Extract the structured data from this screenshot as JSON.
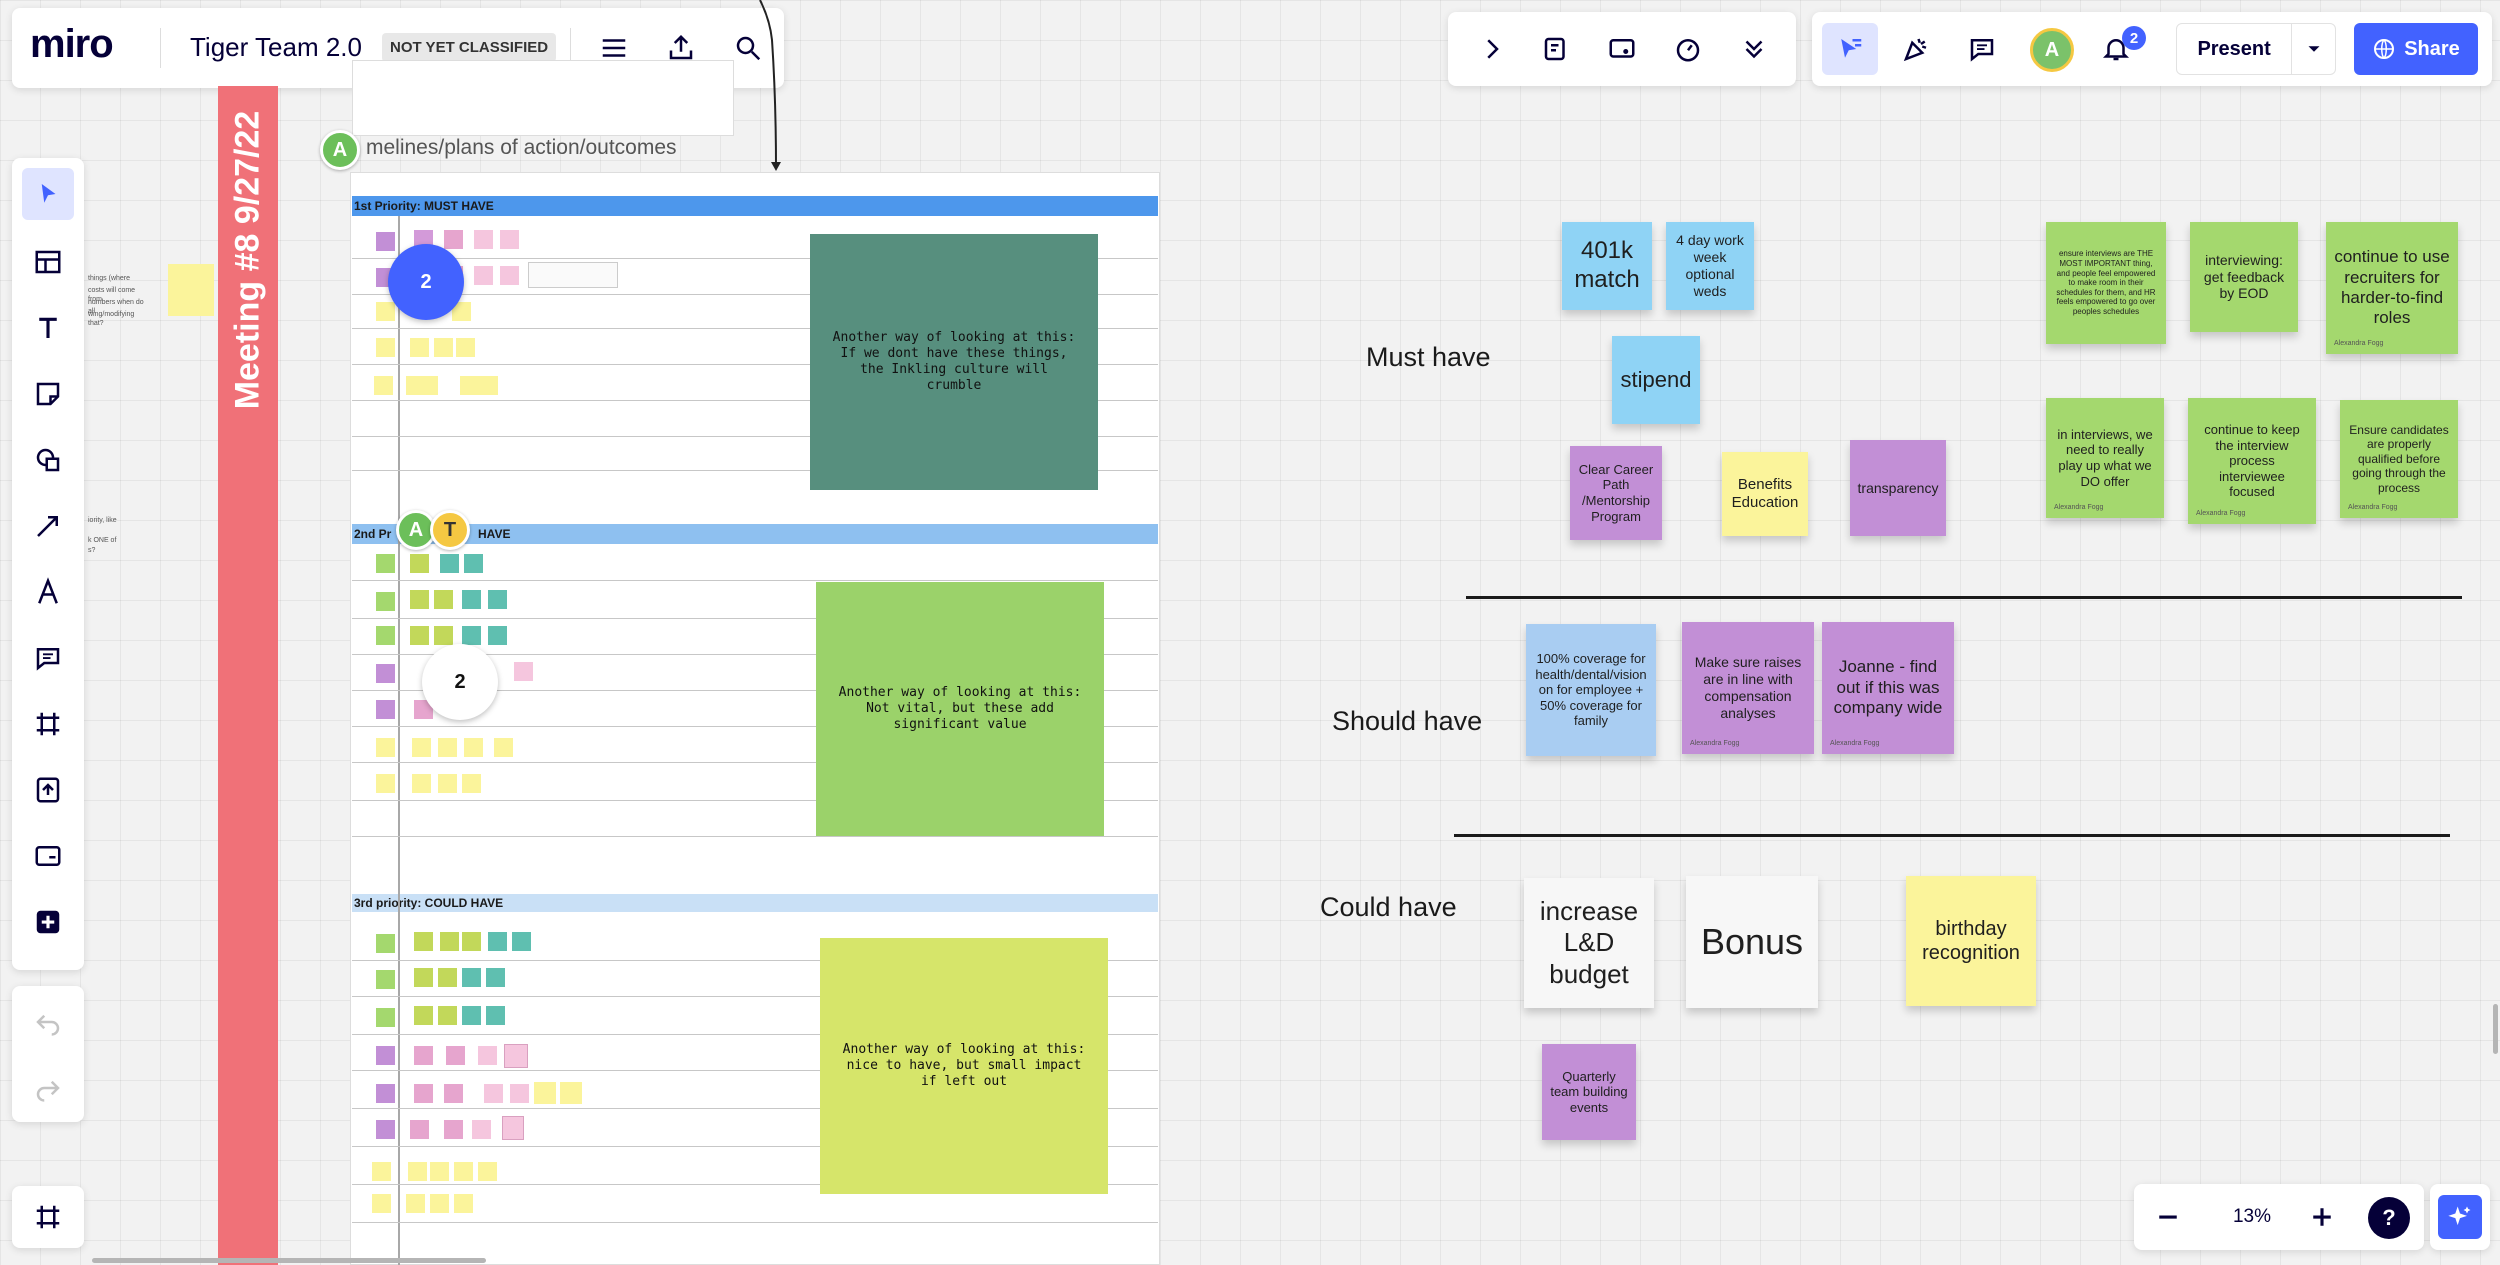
{
  "topbar": {
    "logo": "miro",
    "board_title": "Tiger Team 2.0",
    "classification_badge": "NOT YET CLASSIFIED"
  },
  "right_toolbar": {
    "avatar_initial": "A",
    "notifications_count": "2",
    "present_label": "Present",
    "share_label": "Share"
  },
  "meeting_banner": "Meeting #8 9/27/22",
  "frame": {
    "title_text": "melines/plans of action/outcomes",
    "cursor_avatar": "A",
    "priority1_label": "1st Priority: MUST HAVE",
    "priority2_label_left": "2nd Pr",
    "priority2_label_right": "HAVE",
    "priority3_label": "3rd priority: COULD HAVE",
    "box1_text": "Another way of looking at this:\nIf we dont have these things, the Inkling culture will crumble",
    "box2_text": "Another way of looking at this:\nNot vital, but these add significant value",
    "box3_text": "Another way of looking at this:\nnice to have, but small impact if left out",
    "badge1": "2",
    "badge2": "2",
    "collab_a": "A",
    "collab_t": "T"
  },
  "left_snippets": {
    "line1": "things (where",
    "line2": "costs will come from",
    "line3": "numbers when do all",
    "line4": "wing/modifying that?",
    "line5": "iority, like",
    "line6": "k ONE of",
    "line7": "s?"
  },
  "sections": {
    "must_have": "Must have",
    "should_have": "Should have",
    "could_have": "Could have"
  },
  "stickies": {
    "s401k": "401k match",
    "s4day": "4 day work week optional weds",
    "stipend": "stipend",
    "career": "Clear Career Path /Mentorship Program",
    "benefits": "Benefits Education",
    "transparency": "transparency",
    "ensure_interviews": "ensure interviews are THE MOST IMPORTANT thing, and people feel empowered to make room in their schedules for them, and HR feels empowered to go over peoples schedules",
    "interviewing_feedback": "interviewing: get feedback by EOD",
    "recruiters": "continue to use recruiters for harder-to-find roles",
    "play_up": "in interviews, we need to really play up what we DO offer",
    "interviewee_focused": "continue to keep the interview process interviewee focused",
    "qualified": "Ensure candidates are properly qualified before going through the process",
    "coverage": "100% coverage for health/dental/vision on for employee + 50% coverage for family",
    "raises": "Make sure raises are in line with compensation analyses",
    "joanne": "Joanne - find out if this was company wide",
    "ld_budget": "increase L&D budget",
    "bonus": "Bonus",
    "birthday": "birthday recognition",
    "team_building": "Quarterly team building events",
    "author": "Alexandra Fogg"
  },
  "zoom": {
    "level": "13%",
    "help": "?"
  },
  "colors": {
    "accent_blue": "#4262ff",
    "banner_red": "#f07178",
    "priority1_bar": "#4d97ec",
    "priority2_bar": "#8ec0f0",
    "priority3_bar": "#c9e0f6"
  }
}
